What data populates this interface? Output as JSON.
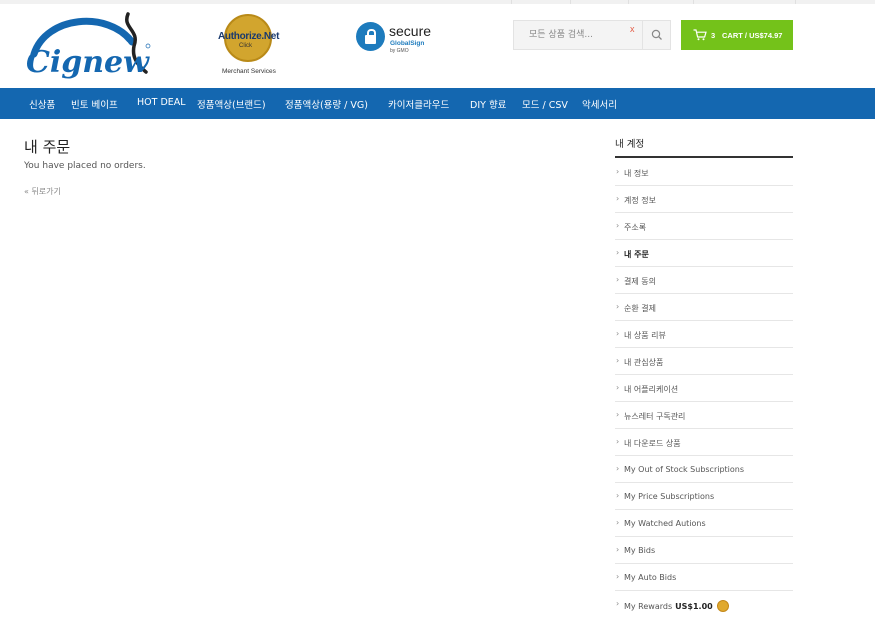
{
  "header": {
    "logo_text": "Cignew",
    "badges": {
      "authorize_net": "Authorize.Net",
      "authorize_click": "Click",
      "merchant_services": "Merchant Services",
      "ssl_secure": "secure",
      "ssl_globalsign": "GlobalSign",
      "ssl_gmo": "by GMO"
    },
    "search": {
      "placeholder": "모든 상품 검색...",
      "clear_icon": "x",
      "search_icon": "search-icon"
    },
    "cart": {
      "count": "3",
      "label": "CART / US$74.97",
      "icon": "cart-icon"
    }
  },
  "nav": {
    "items": [
      "신상품",
      "빈토 베이프",
      "HOT DEAL",
      "정품액상(브랜드)",
      "정품액상(용량 / VG)",
      "카이저클라우드",
      "DIY 향료",
      "모드 / CSV",
      "악세서리"
    ]
  },
  "main": {
    "title": "내 주문",
    "empty_message": "You have placed no orders.",
    "back_link": "« 뒤로가기"
  },
  "sidebar": {
    "title": "내 계정",
    "chevron": "›",
    "items": [
      {
        "label": "내 정보"
      },
      {
        "label": "계정 정보"
      },
      {
        "label": "주소록"
      },
      {
        "label": "내 주문"
      },
      {
        "label": "결제 동의"
      },
      {
        "label": "순환 결제"
      },
      {
        "label": "내 상품 리뷰"
      },
      {
        "label": "내 관심상품"
      },
      {
        "label": "내 어플리케이션"
      },
      {
        "label": "뉴스레터 구독관리"
      },
      {
        "label": "내 다운로드 상품"
      },
      {
        "label": "My Out of Stock Subscriptions"
      },
      {
        "label": "My Price Subscriptions"
      },
      {
        "label": "My Watched Autions"
      },
      {
        "label": "My Bids"
      },
      {
        "label": "My Auto Bids"
      },
      {
        "label": "My Rewards",
        "amount": "US$1.00"
      }
    ],
    "active_index": 3
  },
  "colors": {
    "nav_bg": "#1467b0",
    "cart_bg": "#74c21a",
    "logo_blue": "#1467b0"
  }
}
